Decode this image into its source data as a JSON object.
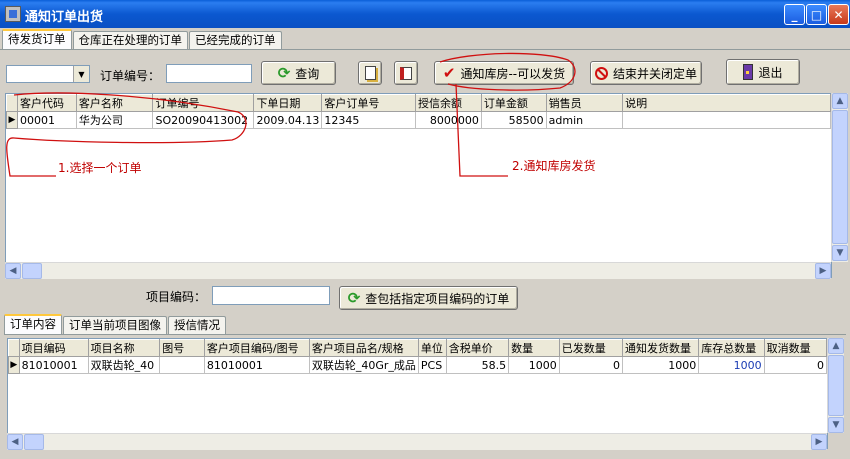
{
  "window": {
    "title": "通知订单出货"
  },
  "main_tabs": [
    {
      "label": "待发货订单"
    },
    {
      "label": "仓库正在处理的订单"
    },
    {
      "label": "已经完成的订单"
    }
  ],
  "toolbar": {
    "order_no_label": "订单编号：",
    "order_no_value": "",
    "query_label": "查询",
    "notify_label": "通知库房--可以发货",
    "close_order_label": "结束并关闭定单",
    "exit_label": "退出"
  },
  "orders": {
    "columns": [
      "客户代码",
      "客户名称",
      "订单编号",
      "下单日期",
      "客户订单号",
      "授信余额",
      "订单金额",
      "销售员",
      "说明"
    ],
    "rows": [
      [
        "00001",
        "华为公司",
        "SO20090413002",
        "2009.04.13",
        "12345",
        "8000000",
        "58500",
        "admin",
        ""
      ]
    ]
  },
  "annotations": {
    "step1": "1.选择一个订单",
    "step2": "2.通知库房发货"
  },
  "item_search": {
    "label": "项目编码：",
    "value": "",
    "button_label": "查包括指定项目编码的订单"
  },
  "detail_tabs": [
    {
      "label": "订单内容"
    },
    {
      "label": "订单当前项目图像"
    },
    {
      "label": "授信情况"
    }
  ],
  "details": {
    "columns": [
      "项目编码",
      "项目名称",
      "图号",
      "客户项目编码/图号",
      "客户项目品名/规格",
      "单位",
      "含税单价",
      "数量",
      "已发数量",
      "通知发货数量",
      "库存总数量",
      "取消数量"
    ],
    "rows": [
      [
        "81010001",
        "双联齿轮_40",
        "",
        "81010001",
        "双联齿轮_40Gr_成品",
        "PCS",
        "58.5",
        "1000",
        "0",
        "1000",
        "1000",
        "0"
      ]
    ]
  },
  "colors": {
    "title_bar": "#0a5fd8",
    "annotation_red": "#c00000",
    "window_bg": "#d4d0c8"
  }
}
